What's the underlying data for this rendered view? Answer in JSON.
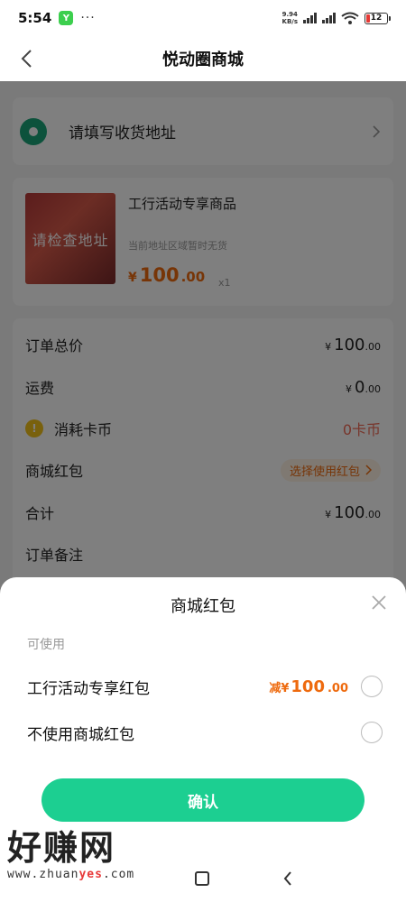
{
  "status_bar": {
    "time": "5:54",
    "app_badge": "Y",
    "dots": "···",
    "net_speed_value": "9.94",
    "net_speed_unit": "KB/s",
    "battery": "12"
  },
  "header": {
    "title": "悦动圈商城"
  },
  "address": {
    "placeholder": "请填写收货地址"
  },
  "product": {
    "image_overlay": "请检查地址",
    "name": "工行活动专享商品",
    "note": "当前地址区域暂时无货",
    "currency": "¥",
    "price_int": "100",
    "price_dec": ".00",
    "quantity": "x1"
  },
  "summary": {
    "total_label": "订单总价",
    "total_currency": "¥",
    "total_int": "100",
    "total_dec": ".00",
    "shipping_label": "运费",
    "shipping_currency": "¥",
    "shipping_int": "0",
    "shipping_dec": ".00",
    "coins_label": "消耗卡币",
    "coins_value": "0卡币",
    "coupon_label": "商城红包",
    "coupon_action": "选择使用红包",
    "subtotal_label": "合计",
    "subtotal_currency": "¥",
    "subtotal_int": "100",
    "subtotal_dec": ".00",
    "remark_label": "订单备注"
  },
  "sheet": {
    "title": "商城红包",
    "section": "可使用",
    "option1_label": "工行活动专享红包",
    "option1_prefix": "减¥",
    "option1_int": "100",
    "option1_dec": ".00",
    "option2_label": "不使用商城红包",
    "confirm": "确认"
  },
  "watermark": {
    "big": "好赚网",
    "url_pre": "www.zhuan",
    "url_hl": "yes",
    "url_post": ".com"
  },
  "colors": {
    "accent_green": "#1ccf91",
    "price_orange": "#ee6a0e"
  }
}
